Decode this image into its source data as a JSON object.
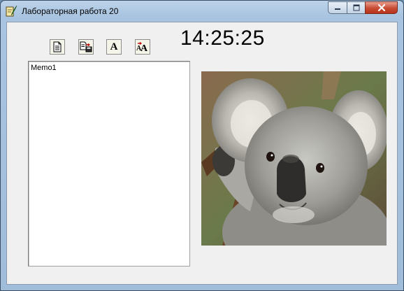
{
  "window": {
    "title": "Лабораторная работа 20",
    "icon": "app-feather-icon",
    "controls": {
      "minimize": "minimize-icon",
      "maximize": "maximize-icon",
      "close": "close-icon"
    }
  },
  "toolbar": {
    "buttons": [
      {
        "name": "new-document-button",
        "icon": "document-icon"
      },
      {
        "name": "save-document-button",
        "icon": "save-document-icon"
      },
      {
        "name": "font-button",
        "icon": "font-icon",
        "glyph": "A"
      },
      {
        "name": "font-size-button",
        "icon": "font-size-icon",
        "glyph": "AA"
      }
    ]
  },
  "clock": {
    "time": "14:25:25"
  },
  "memo": {
    "text": "Memo1"
  },
  "image": {
    "subject": "koala-photo"
  },
  "colors": {
    "client_bg": "#f0f0f0",
    "title_bar": "#bcd3ea",
    "close_button": "#c74a33"
  }
}
